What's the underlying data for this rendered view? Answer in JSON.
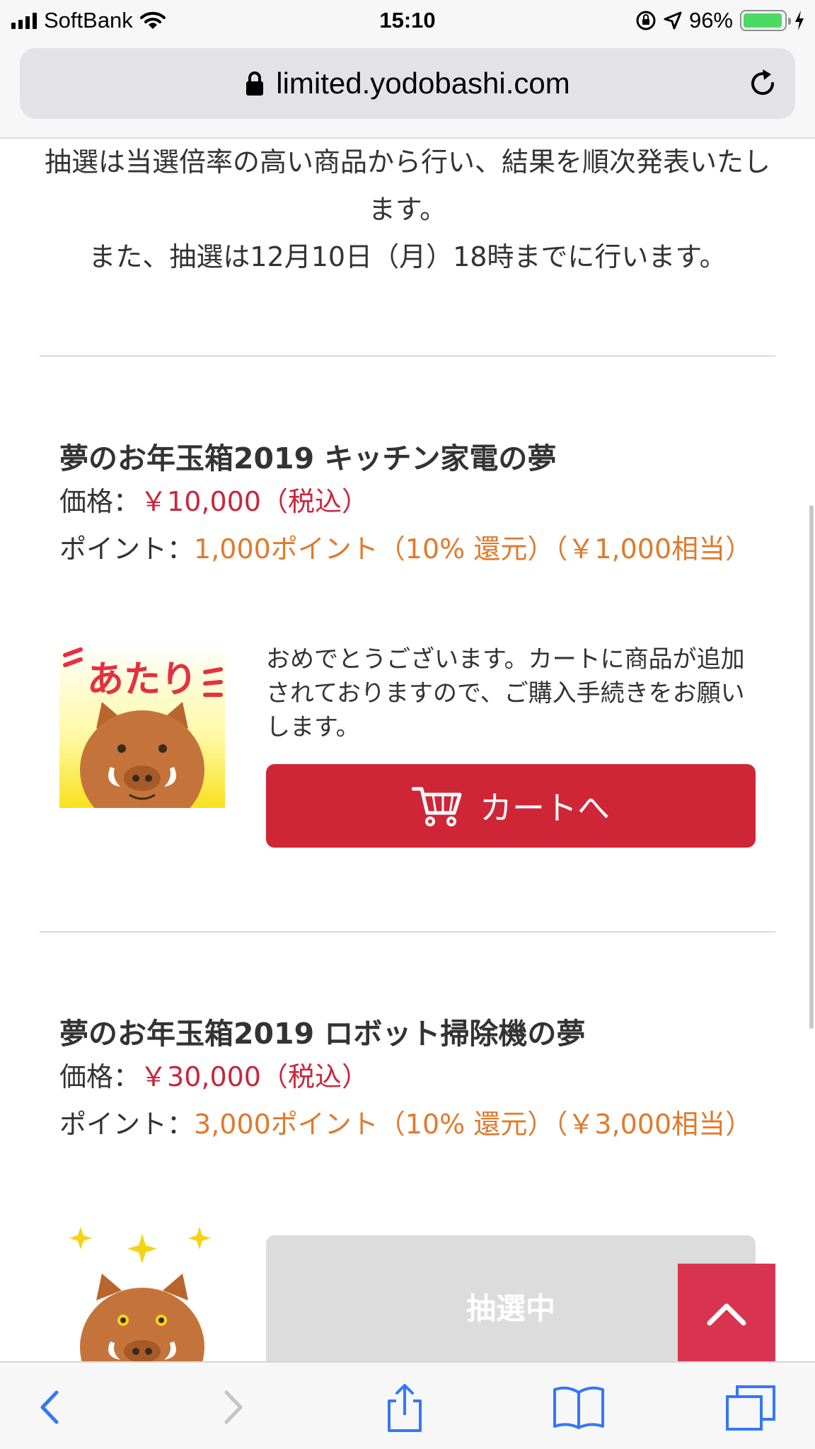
{
  "status_bar": {
    "carrier": "SoftBank",
    "time": "15:10",
    "battery_percent": "96%",
    "battery_level": 0.96
  },
  "browser": {
    "url": "limited.yodobashi.com"
  },
  "notice": {
    "line1": "抽選は当選倍率の高い商品から行い、結果を順次発表いたします。",
    "line2": "また、抽選は12月10日（月）18時までに行います。"
  },
  "products": [
    {
      "title": "夢のお年玉箱2019 キッチン家電の夢",
      "price_label": "価格：",
      "price": "￥10,000（税込）",
      "points_label": "ポイント：",
      "points": "1,000ポイント（10% 還元）（￥1,000相当）",
      "result_image_text": "あたり",
      "message": "おめでとうございます。カートに商品が追加されておりますので、ご購入手続きをお願いします。",
      "button_label": "カートへ"
    },
    {
      "title": "夢のお年玉箱2019 ロボット掃除機の夢",
      "price_label": "価格：",
      "price": "￥30,000（税込）",
      "points_label": "ポイント：",
      "points": "3,000ポイント（10% 還元）（￥3,000相当）",
      "button_label": "抽選中"
    }
  ],
  "colors": {
    "price": "#c9263b",
    "points": "#e07a2c",
    "cart_button": "#cf2637",
    "pending_button": "#dcdcdc",
    "scroll_top_button": "#d9344f",
    "ios_blue": "#3478f6"
  },
  "icons": {
    "cart": "shopping-cart-icon",
    "scroll_top": "chevron-up-icon",
    "back": "chevron-left-icon",
    "forward": "chevron-right-icon",
    "share": "share-icon",
    "bookmarks": "book-icon",
    "tabs": "tabs-icon",
    "lock": "lock-icon",
    "reload": "reload-icon"
  }
}
